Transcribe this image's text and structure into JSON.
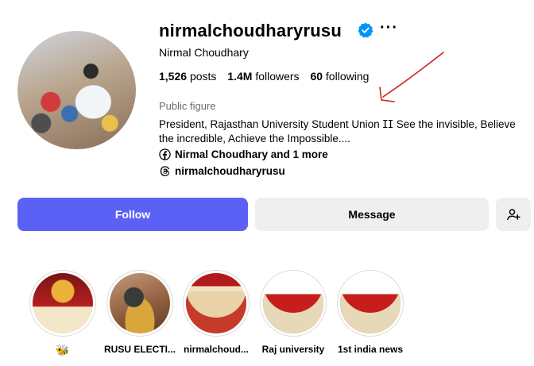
{
  "profile": {
    "username": "nirmalchoudharyrusu",
    "full_name": "Nirmal Choudhary",
    "category": "Public figure",
    "bio": "President, Rajasthan University Student Union ⵊⵊ See the invisible, Believe the incredible, Achieve the Impossible....",
    "facebook_link": "Nirmal Choudhary and 1 more",
    "threads_link": "nirmalchoudharyrusu"
  },
  "stats": {
    "posts_count": "1,526",
    "posts_label": "posts",
    "followers_count": "1.4M",
    "followers_label": "followers",
    "following_count": "60",
    "following_label": "following"
  },
  "actions": {
    "follow_label": "Follow",
    "message_label": "Message"
  },
  "highlights": [
    {
      "label": "🐝"
    },
    {
      "label": "RUSU ELECTI..."
    },
    {
      "label": "nirmalchoud..."
    },
    {
      "label": "Raj university"
    },
    {
      "label": "1st india news"
    }
  ],
  "colors": {
    "follow_button": "#5b61f4",
    "secondary_button": "#efefef",
    "verified_badge": "#0095f6",
    "annotation_arrow": "#d42020"
  },
  "icons": [
    "verified-badge-icon",
    "more-options-icon",
    "facebook-icon",
    "threads-icon",
    "add-person-icon"
  ]
}
